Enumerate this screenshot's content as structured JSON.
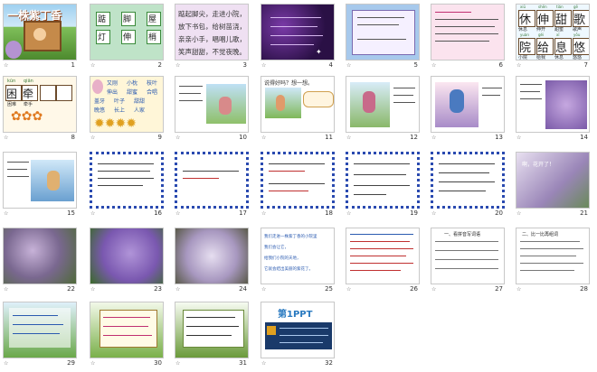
{
  "slides": [
    {
      "num": "1",
      "kind": "title"
    },
    {
      "num": "2",
      "kind": "chars"
    },
    {
      "num": "3",
      "kind": "poem"
    },
    {
      "num": "4",
      "kind": "star"
    },
    {
      "num": "5",
      "kind": "bluepanel"
    },
    {
      "num": "6",
      "kind": "pinkpanel"
    },
    {
      "num": "7",
      "kind": "cards"
    },
    {
      "num": "8",
      "kind": "grid"
    },
    {
      "num": "9",
      "kind": "words"
    },
    {
      "num": "10",
      "kind": "textpic"
    },
    {
      "num": "11",
      "kind": "picq"
    },
    {
      "num": "12",
      "kind": "textpic"
    },
    {
      "num": "13",
      "kind": "textpic"
    },
    {
      "num": "14",
      "kind": "textpic"
    },
    {
      "num": "15",
      "kind": "textpic"
    },
    {
      "num": "16",
      "kind": "dotted"
    },
    {
      "num": "17",
      "kind": "dotted"
    },
    {
      "num": "18",
      "kind": "dotted"
    },
    {
      "num": "19",
      "kind": "dotted"
    },
    {
      "num": "20",
      "kind": "dotted"
    },
    {
      "num": "21",
      "kind": "photo"
    },
    {
      "num": "22",
      "kind": "photo"
    },
    {
      "num": "23",
      "kind": "photo"
    },
    {
      "num": "24",
      "kind": "photo"
    },
    {
      "num": "25",
      "kind": "bluetext"
    },
    {
      "num": "26",
      "kind": "bluetext"
    },
    {
      "num": "27",
      "kind": "list"
    },
    {
      "num": "28",
      "kind": "list"
    },
    {
      "num": "29",
      "kind": "tree"
    },
    {
      "num": "30",
      "kind": "tree"
    },
    {
      "num": "31",
      "kind": "tree"
    },
    {
      "num": "32",
      "kind": "ppt"
    }
  ],
  "slide1": {
    "title": "一株紫丁香"
  },
  "slide2": {
    "chars": [
      "踮",
      "脚",
      "屋",
      "灯",
      "伸",
      "梢"
    ]
  },
  "slide3": {
    "lines": [
      "踮起脚尖，走进小院，",
      "放下书包，给树苗浇，",
      "亲亲小手，唱唱儿歌，",
      "笑声甜甜，不觉夜晚。"
    ]
  },
  "slide7": {
    "chars": [
      "休",
      "伸",
      "甜",
      "歌",
      "院",
      "给",
      "息",
      "悠"
    ],
    "pinyin": [
      "xiū",
      "shēn",
      "tián",
      "gē",
      "yuàn",
      "gěi",
      "xī",
      "yōu"
    ],
    "words": [
      "休息",
      "伸开",
      "甜蜜",
      "歌声",
      "小院",
      "给我",
      "休息",
      "悠悠"
    ]
  },
  "slide8": {
    "pinyin": [
      "kūn",
      "qiān"
    ],
    "chars": [
      "困",
      "牵"
    ],
    "words": [
      "困难",
      "牵手"
    ]
  },
  "slide9": {
    "words": [
      "又刚",
      "小枕",
      "枝叶",
      "伸出",
      "甜蜜",
      "合唱",
      "盖牙",
      "叶子",
      "甜甜",
      "晚悠",
      "长上",
      "人家"
    ]
  },
  "slide11": {
    "q": "说得好吗？想一想。"
  },
  "slide21": {
    "text": "啊，花开了！"
  },
  "slide25": {
    "lines": [
      "我们走进一株紫丁香的小院里",
      "我们会让它，",
      "给我们小院的天地，",
      "它就会结出美丽的紫花了。"
    ]
  },
  "slide27": {
    "title": "一、看拼音写词语"
  },
  "slide28": {
    "title": "二、比一比再组词"
  },
  "slide32": {
    "logo": "第1PPT"
  },
  "colors": {
    "sky": "#7fb3e0",
    "pink": "#f7d7e6",
    "lilac": "#a98ccb",
    "green": "#5f9e3c",
    "purple": "#5a2a8a",
    "darkpurple": "#2a1045"
  }
}
